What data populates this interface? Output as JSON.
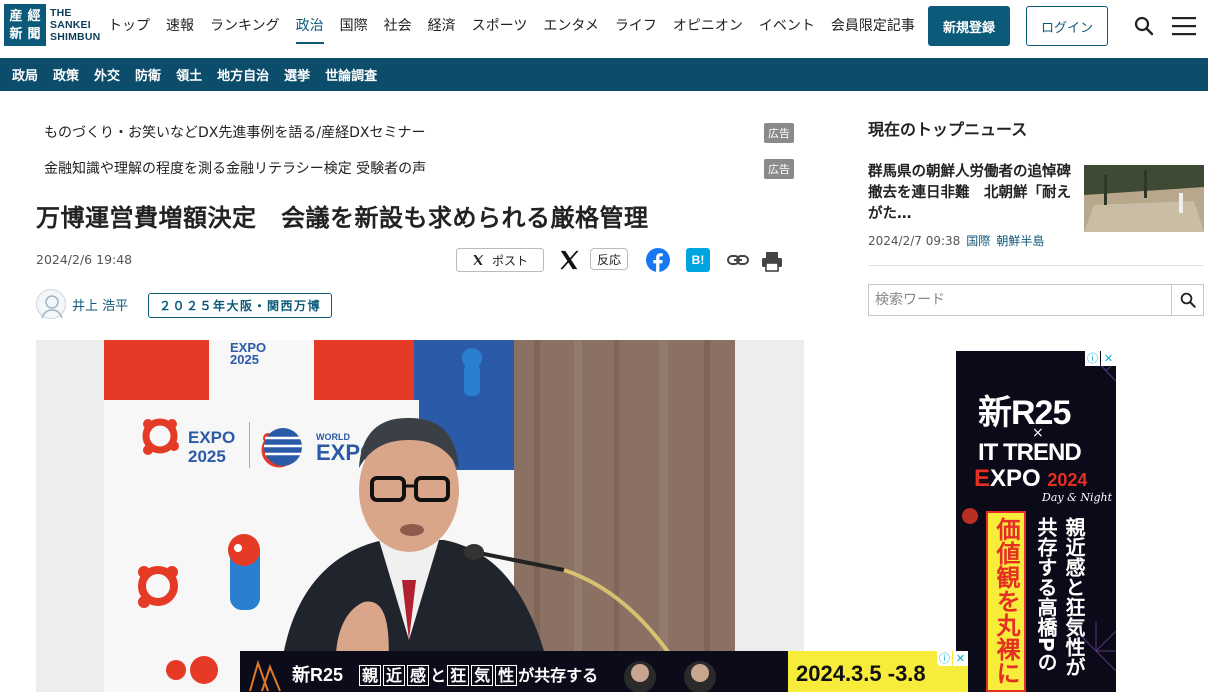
{
  "site": {
    "logo_text": [
      "THE",
      "SANKEI",
      "SHIMBUN"
    ],
    "logo_glyphs": [
      "産",
      "經",
      "新",
      "聞"
    ]
  },
  "gnav": {
    "items": [
      {
        "label": "トップ",
        "active": false
      },
      {
        "label": "速報",
        "active": false
      },
      {
        "label": "ランキング",
        "active": false
      },
      {
        "label": "政治",
        "active": true
      },
      {
        "label": "国際",
        "active": false
      },
      {
        "label": "社会",
        "active": false
      },
      {
        "label": "経済",
        "active": false
      },
      {
        "label": "スポーツ",
        "active": false
      },
      {
        "label": "エンタメ",
        "active": false
      },
      {
        "label": "ライフ",
        "active": false
      },
      {
        "label": "オピニオン",
        "active": false
      },
      {
        "label": "イベント",
        "active": false
      },
      {
        "label": "会員限定記事",
        "active": false
      }
    ],
    "register_label": "新規登録",
    "login_label": "ログイン",
    "search_icon": "search-icon",
    "menu_icon": "hamburger-menu-icon"
  },
  "subnav": {
    "items": [
      "政局",
      "政策",
      "外交",
      "防衛",
      "領土",
      "地方自治",
      "選挙",
      "世論調査"
    ]
  },
  "promos": [
    {
      "text": "ものづくり・お笑いなどDX先進事例を語る/産経DXセミナー",
      "badge": "広告"
    },
    {
      "text": "金融知識や理解の程度を測る金融リテラシー検定 受験者の声",
      "badge": "広告"
    }
  ],
  "article": {
    "title": "万博運営費増額決定　会議を新設も求められる厳格管理",
    "date": "2024/2/6 19:48",
    "share": {
      "post_label": "ポスト",
      "react_label": "反応"
    },
    "author": "井上 浩平",
    "tag": "２０２５年大阪・関西万博",
    "photo_text": {
      "expo_small": "EXPO\n2025",
      "expo_mid": "EXPO",
      "expo_year": "2025",
      "world": "WORLD",
      "expo_right": "EXPO"
    }
  },
  "sidebar": {
    "heading": "現在のトップニュース",
    "news": {
      "title": "群馬県の朝鮮人労働者の追悼碑撤去を連日非難　北朝鮮「耐えがた…",
      "date": "2024/2/7 09:38",
      "category": "国際",
      "subcategory": "朝鮮半島"
    },
    "search": {
      "placeholder": "検索ワード"
    }
  },
  "ads": {
    "side": {
      "brand": "新R25",
      "times": "×",
      "event_line1": "IT TREND",
      "event_line2_red": "E",
      "event_line2": "XPO",
      "event_year": "2024",
      "tagline": "Day & Night",
      "col1": "親近感と狂気性が",
      "col2": "共存する高橋Pの",
      "col3": "価値観を丸裸に"
    },
    "bottom": {
      "brand": "新R25",
      "copy_boxes": [
        "親",
        "近",
        "感",
        "と",
        "狂",
        "気",
        "性"
      ],
      "copy_tail": "が共存する",
      "dates": "2024.3.5 -3.8"
    },
    "info_glyph": "ⓘ",
    "close_glyph": "✕"
  },
  "colors": {
    "brand": "#0c5a7a",
    "subnav_bg": "#0c4d6c",
    "hatena": "#00a4de",
    "facebook": "#1877f2",
    "ad_yellow": "#f7ec3a",
    "ad_red": "#e52f25"
  }
}
